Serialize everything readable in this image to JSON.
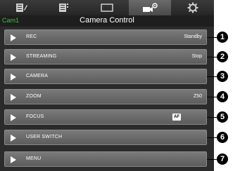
{
  "tabs": [
    {
      "icon": "notes-icon"
    },
    {
      "icon": "list-icon"
    },
    {
      "icon": "window-icon"
    },
    {
      "icon": "camera-settings-icon",
      "active": true
    },
    {
      "icon": "gear-icon"
    }
  ],
  "header": {
    "cam": "Cam1",
    "title": "Camera Control"
  },
  "rows": [
    {
      "label": "REC",
      "status": "Standby",
      "callout": "1"
    },
    {
      "label": "STREAMING",
      "status": "Stop",
      "callout": "2"
    },
    {
      "label": "CAMERA",
      "status": "",
      "callout": "3"
    },
    {
      "label": "ZOOM",
      "status": "Z50",
      "callout": "4"
    },
    {
      "label": "FOCUS",
      "status": "",
      "badge": "AF",
      "callout": "5"
    },
    {
      "label": "USER SWITCH",
      "status": "",
      "callout": "6"
    },
    {
      "label": "MENU",
      "status": "",
      "callout": "7"
    }
  ]
}
